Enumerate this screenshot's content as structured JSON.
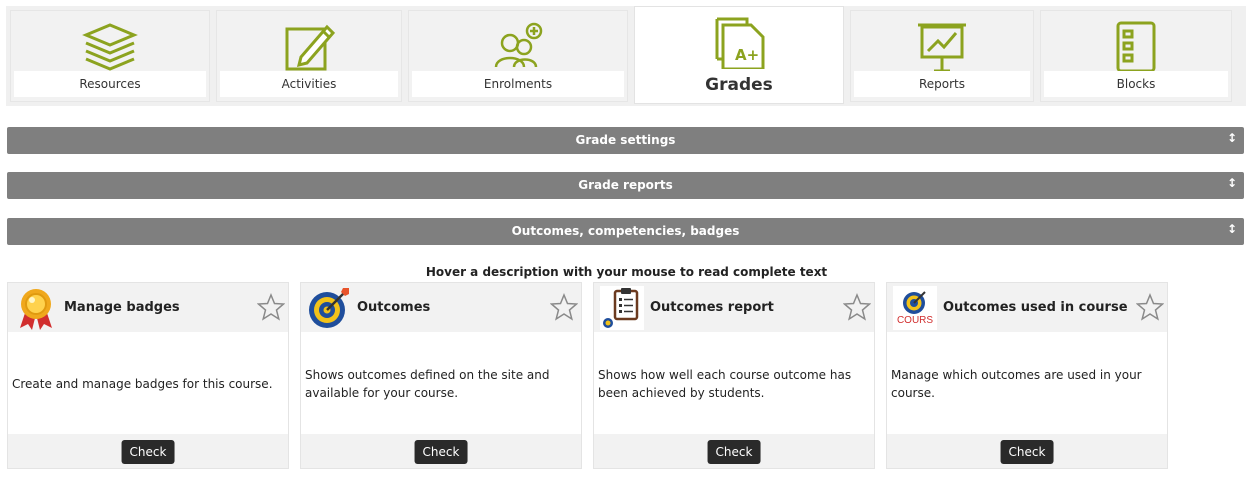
{
  "tabs": [
    {
      "label": "Resources",
      "icon": "layers-icon"
    },
    {
      "label": "Activities",
      "icon": "pencil-edit-icon"
    },
    {
      "label": "Enrolments",
      "icon": "users-add-icon"
    },
    {
      "label": "Grades",
      "icon": "grade-a-plus-icon",
      "active": true
    },
    {
      "label": "Reports",
      "icon": "presentation-chart-icon"
    },
    {
      "label": "Blocks",
      "icon": "blocks-list-icon"
    }
  ],
  "sections": [
    {
      "label": "Grade settings",
      "toggle": "↕"
    },
    {
      "label": "Grade reports",
      "toggle": "↕"
    },
    {
      "label": "Outcomes, competencies, badges",
      "toggle": "↕"
    }
  ],
  "hint": "Hover a description with your mouse to read complete text",
  "cards": [
    {
      "title": "Manage badges",
      "description": "Create and manage badges for this course.",
      "button": "Check",
      "icon": "badge-medal-icon"
    },
    {
      "title": "Outcomes",
      "description": "Shows outcomes defined on the site and available for your course.",
      "button": "Check",
      "icon": "target-icon"
    },
    {
      "title": "Outcomes report",
      "description": "Shows how well each course outcome has been achieved by students.",
      "button": "Check",
      "icon": "clipboard-report-icon"
    },
    {
      "title": "Outcomes used in course",
      "description": "Manage which outcomes are used in your course.",
      "button": "Check",
      "icon": "target-cours-icon",
      "icon_text": "COURS"
    }
  ],
  "colors": {
    "icon_green": "#8ca31f",
    "bar_gray": "#7f7f7f",
    "button_dark": "#2a2a2a"
  }
}
